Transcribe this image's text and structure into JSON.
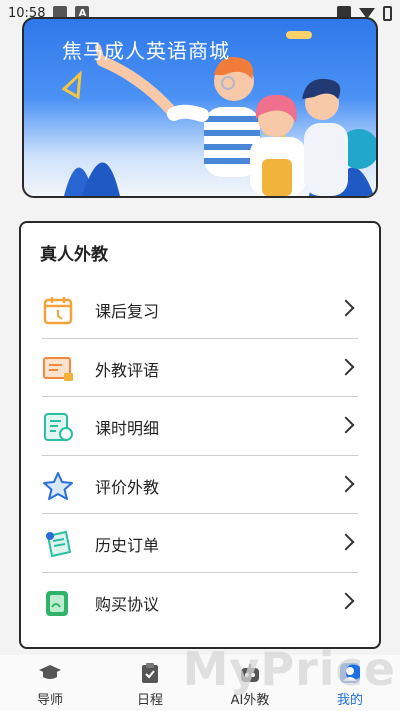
{
  "status_bar": {
    "time": "10:58",
    "icon_a": "A"
  },
  "banner": {
    "title": "焦马成人英语商城"
  },
  "section": {
    "title": "真人外教",
    "items": [
      {
        "label": "课后复习",
        "icon": "calendar-icon",
        "color": "#f2a33a"
      },
      {
        "label": "外教评语",
        "icon": "comment-icon",
        "color": "#f0883e"
      },
      {
        "label": "课时明细",
        "icon": "receipt-icon",
        "color": "#2bbfa2"
      },
      {
        "label": "评价外教",
        "icon": "star-icon",
        "color": "#2a6ed8"
      },
      {
        "label": "历史订单",
        "icon": "order-icon",
        "color": "#2bbfa2"
      },
      {
        "label": "购买协议",
        "icon": "agreement-icon",
        "color": "#2fb36b"
      }
    ]
  },
  "bottom_nav": {
    "items": [
      {
        "label": "导师",
        "icon": "mortarboard-icon"
      },
      {
        "label": "日程",
        "icon": "clipboard-icon"
      },
      {
        "label": "AI外教",
        "icon": "robot-icon"
      },
      {
        "label": "我的",
        "icon": "profile-icon",
        "active": true
      }
    ]
  },
  "watermark": "MyPrice"
}
